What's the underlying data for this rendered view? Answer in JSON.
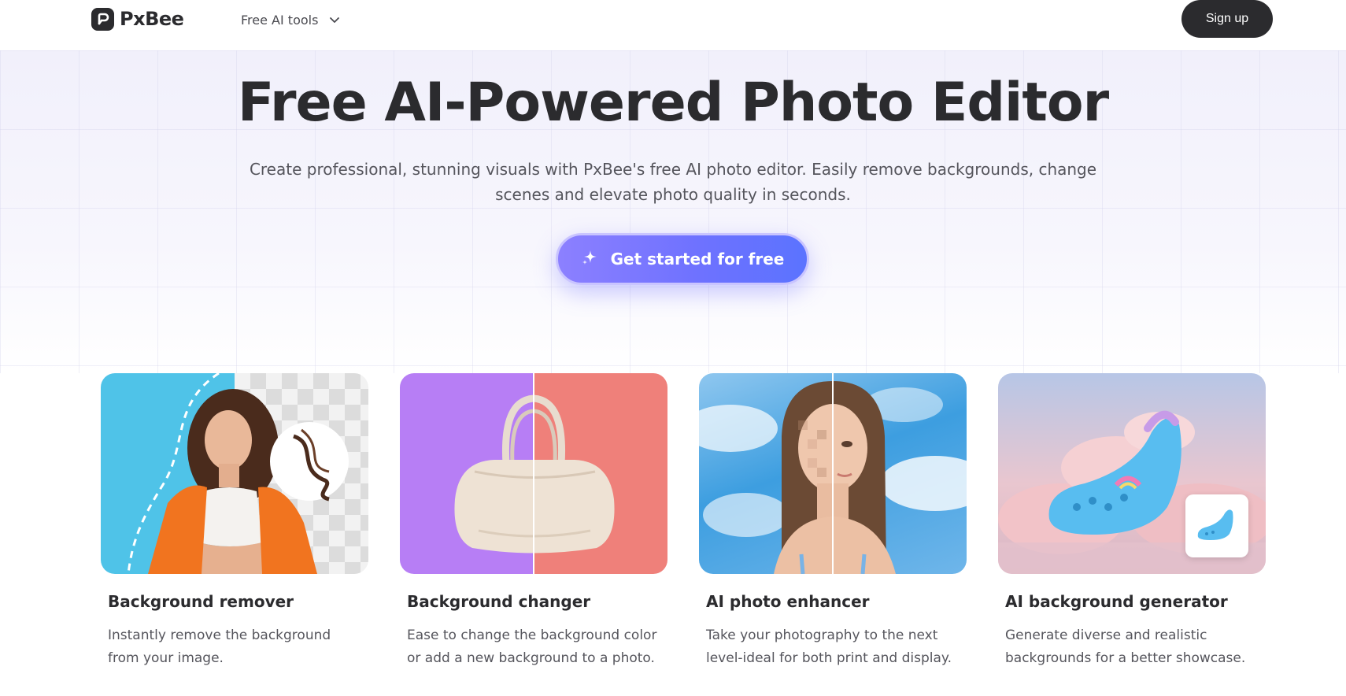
{
  "nav": {
    "logo_text": "PxBee",
    "tools_label": "Free AI tools",
    "signup_label": "Sign up"
  },
  "hero": {
    "title": "Free AI-Powered Photo Editor",
    "subtitle": "Create professional, stunning visuals with PxBee's free AI photo editor. Easily remove backgrounds, change scenes and elevate photo quality in seconds.",
    "cta_label": "Get started for free"
  },
  "cards": [
    {
      "title": "Background remover",
      "description": "Instantly remove the background from your image."
    },
    {
      "title": "Background changer",
      "description": "Ease to change the background color or add a new background to a photo."
    },
    {
      "title": "AI photo enhancer",
      "description": "Take your photography to the next level-ideal for both print and display."
    },
    {
      "title": "AI background generator",
      "description": "Generate diverse and realistic backgrounds for a better showcase."
    }
  ],
  "colors": {
    "primary_dark": "#2b2b2e",
    "cta_gradient_start": "#8c80ff",
    "cta_gradient_end": "#5b73ff",
    "hero_background": "#f4f3fc"
  }
}
